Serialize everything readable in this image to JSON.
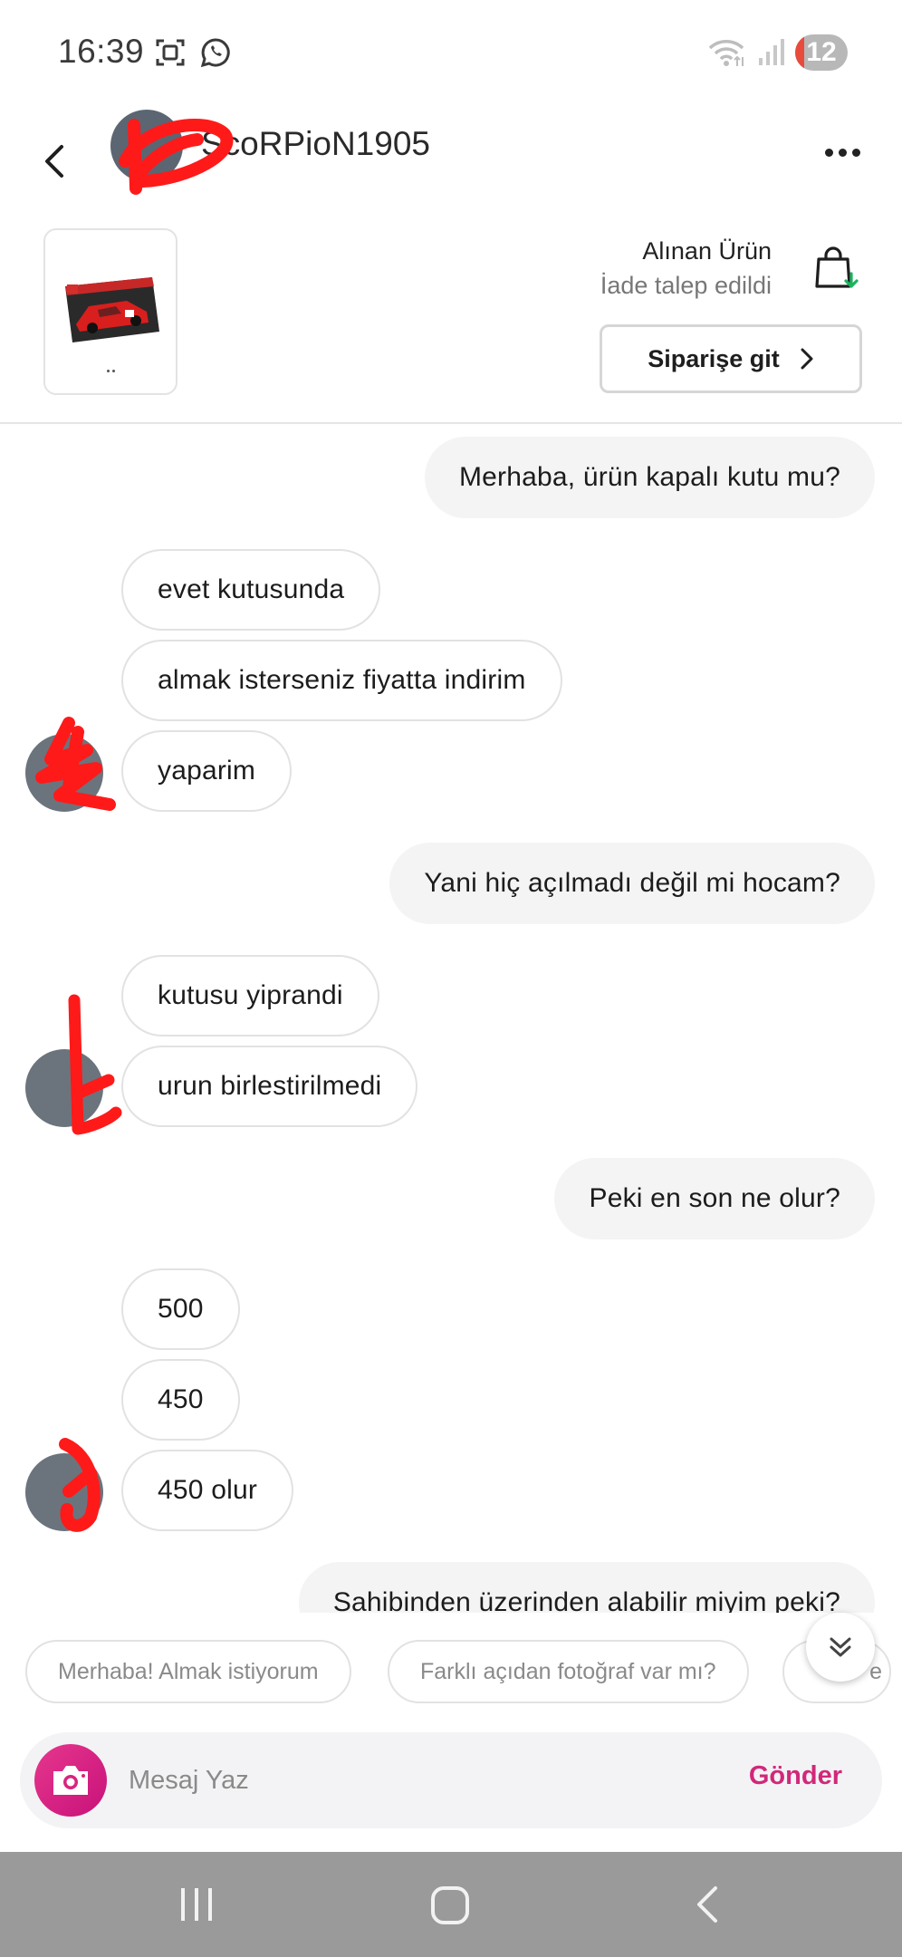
{
  "status_bar": {
    "time": "16:39",
    "badge": "12"
  },
  "header": {
    "username": "ScoRPioN1905"
  },
  "product": {
    "title": "Alınan Ürün",
    "status": "İade talep edildi",
    "order_button": "Siparişe git"
  },
  "messages": [
    {
      "side": "out",
      "text": "Merhaba, ürün kapalı kutu mu?"
    },
    {
      "side": "in",
      "text": "evet kutusunda"
    },
    {
      "side": "in",
      "text": "almak isterseniz fiyatta indirim"
    },
    {
      "side": "in",
      "text": "yaparim"
    },
    {
      "side": "out",
      "text": "Yani hiç açılmadı değil mi hocam?"
    },
    {
      "side": "in",
      "text": "kutusu yiprandi"
    },
    {
      "side": "in",
      "text": "urun birlestirilmedi"
    },
    {
      "side": "out",
      "text": "Peki en son ne olur?"
    },
    {
      "side": "in",
      "text": "500"
    },
    {
      "side": "in",
      "text": "450"
    },
    {
      "side": "in",
      "text": "450 olur"
    },
    {
      "side": "out",
      "text": "Sahibinden üzerinden alabilir miyim peki?"
    }
  ],
  "quick_replies": [
    {
      "label": "Merhaba! Almak istiyorum"
    },
    {
      "label": "Farklı açıdan fotoğraf var mı?"
    },
    {
      "label": "e"
    }
  ],
  "composer": {
    "placeholder": "Mesaj Yaz",
    "send_label": "Gönder"
  },
  "colors": {
    "accent": "#d1287a",
    "camera": "#e6378d",
    "navbar": "#9a9a9a"
  }
}
